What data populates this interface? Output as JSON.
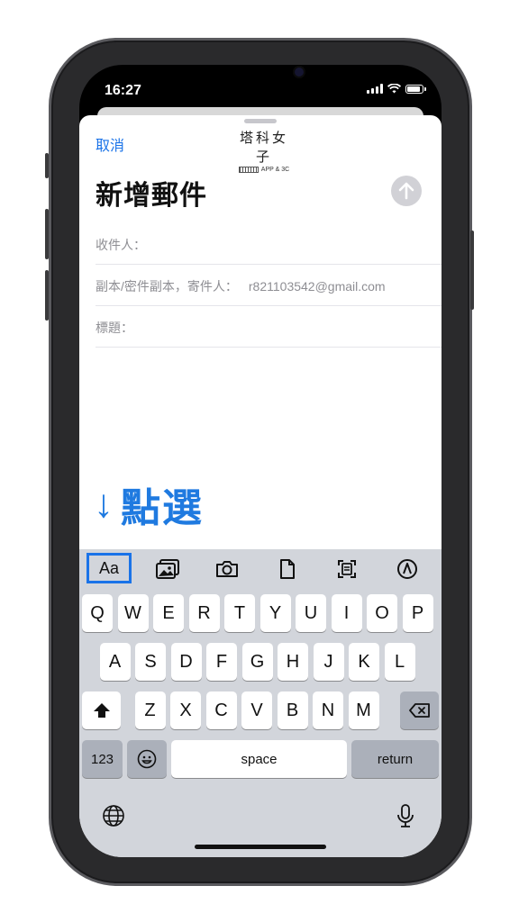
{
  "status": {
    "time": "16:27"
  },
  "compose": {
    "cancel_label": "取消",
    "logo_cn": "塔科女子",
    "logo_en": "APP & 3C",
    "title": "新增郵件",
    "to_label": "收件人：",
    "cc_label": "副本/密件副本，寄件人：",
    "from_value": "r821103542@gmail.com",
    "subject_label": "標題："
  },
  "annotation": {
    "arrow": "↓",
    "text": "點選"
  },
  "toolbar": {
    "format_label": "Aa",
    "icons": [
      "photo-library-icon",
      "camera-icon",
      "document-icon",
      "scan-document-icon",
      "markup-icon"
    ]
  },
  "keyboard": {
    "row1": [
      "Q",
      "W",
      "E",
      "R",
      "T",
      "Y",
      "U",
      "I",
      "O",
      "P"
    ],
    "row2": [
      "A",
      "S",
      "D",
      "F",
      "G",
      "H",
      "J",
      "K",
      "L"
    ],
    "row3": [
      "Z",
      "X",
      "C",
      "V",
      "B",
      "N",
      "M"
    ],
    "numbers_label": "123",
    "space_label": "space",
    "return_label": "return"
  },
  "colors": {
    "accent": "#1a73e8",
    "annotation": "#1f7ae0",
    "keyboard_bg": "#d2d5db"
  }
}
